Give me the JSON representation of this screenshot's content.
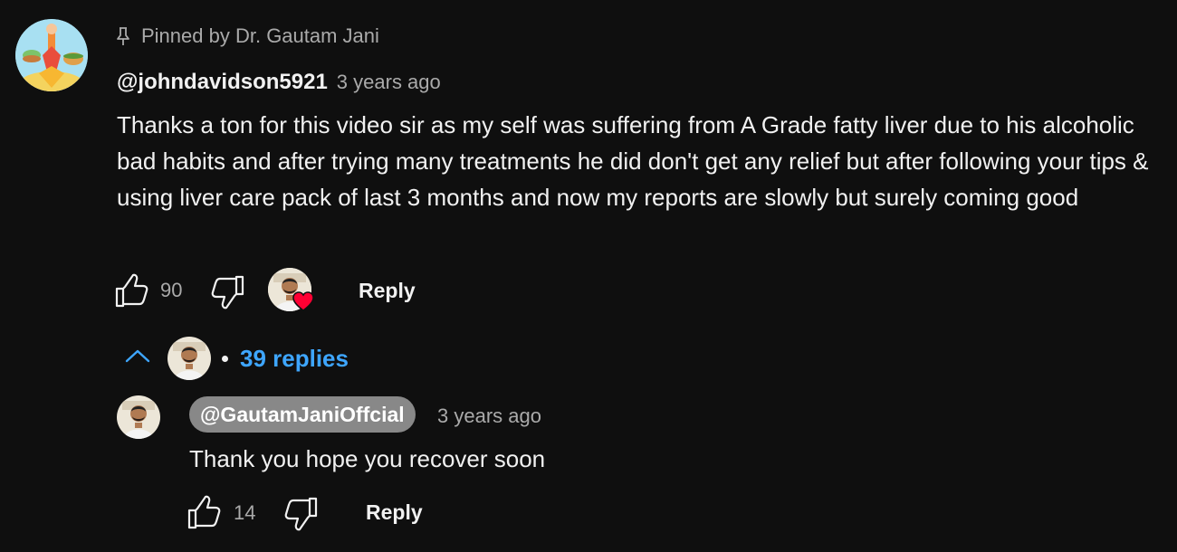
{
  "comment": {
    "pinned_label": "Pinned by Dr. Gautam Jani",
    "author": "@johndavidson5921",
    "time": "3 years ago",
    "text": "Thanks a ton for this video sir as my self was suffering from A Grade fatty liver due to his alcoholic bad habits and after trying many treatments he did don't get any relief but after following your tips & using liver care pack of last 3 months and now my reports are slowly but surely coming good",
    "likes": "90",
    "reply_label": "Reply",
    "creator_heart": true,
    "icons": {
      "pin": "pin-icon",
      "like": "thumbs-up-icon",
      "dislike": "thumbs-down-icon",
      "heart": "heart-icon"
    }
  },
  "replies_toggle": {
    "label": "39 replies",
    "expanded": true,
    "icon": "chevron-up-icon"
  },
  "reply": {
    "author": "@GautamJaniOffcial",
    "time": "3 years ago",
    "text": "Thank you hope you recover soon",
    "likes": "14",
    "reply_label": "Reply"
  },
  "colors": {
    "background": "#0f0f0f",
    "text_primary": "#f1f1f1",
    "text_secondary": "#aaaaaa",
    "link_blue": "#3ea6ff",
    "owner_chip": "#888888",
    "heart_red": "#ff0033"
  }
}
